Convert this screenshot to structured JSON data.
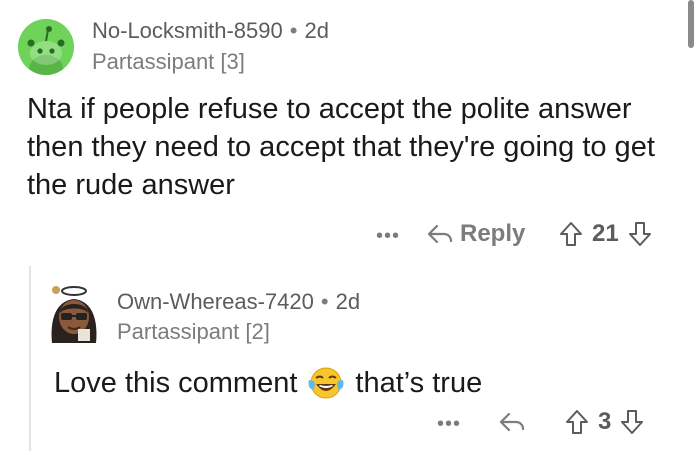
{
  "top_comment": {
    "username": "No-Locksmith-8590",
    "separator": "•",
    "age": "2d",
    "flair": "Partassipant [3]",
    "body": "Nta if people refuse to accept the polite answer then they need to accept that they're going to get the rude answer",
    "more_label": "•••",
    "reply_label": "Reply",
    "score": "21",
    "avatar_color": "#6fd35a"
  },
  "reply_comment": {
    "username": "Own-Whereas-7420",
    "separator": "•",
    "age": "2d",
    "flair": "Partassipant [2]",
    "body_before_emoji": "Love this comment",
    "emoji": "face-with-tears-of-joy",
    "body_after_emoji": "that’s true",
    "more_label": "•••",
    "score": "3"
  },
  "icons": {
    "reply": "reply-arrow-icon",
    "upvote": "upvote-arrow-icon",
    "downvote": "downvote-arrow-icon",
    "more": "more-options-icon"
  }
}
